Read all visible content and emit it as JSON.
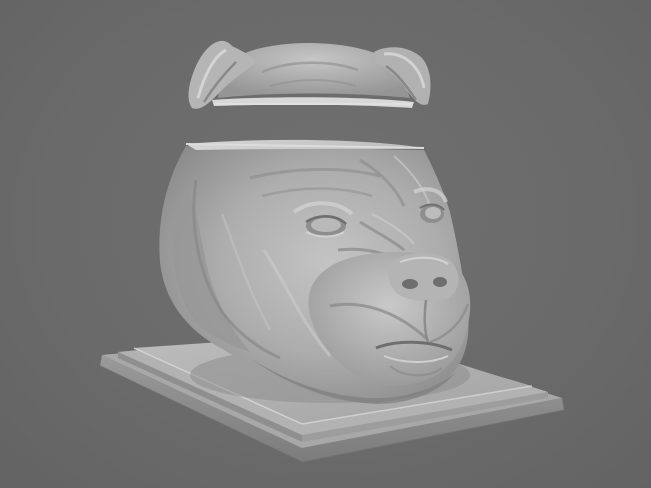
{
  "viewport": {
    "background_color": "#6b6b6b",
    "model_color": "#a9a9a9",
    "model_shadow_color": "#5e5e5e",
    "model_highlight_color": "#cfcfcf"
  },
  "model": {
    "parts": [
      "ears-lid",
      "bulldog-head",
      "base-plinth"
    ]
  }
}
